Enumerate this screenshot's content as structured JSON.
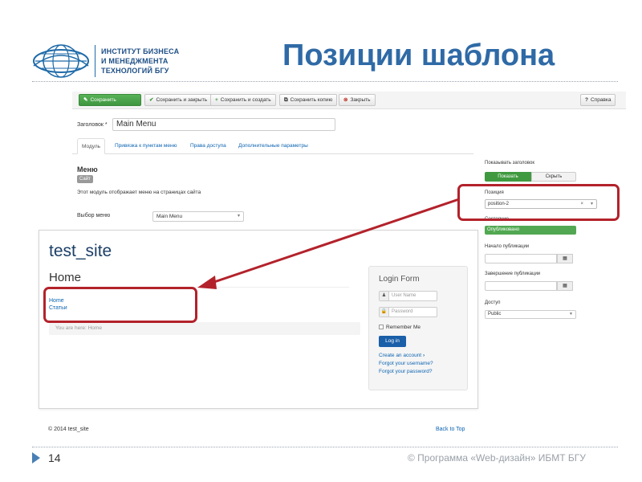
{
  "header": {
    "logo_lines": [
      "ИНСТИТУТ БИЗНЕСА",
      "И МЕНЕДЖМЕНТА",
      "ТЕХНОЛОГИЙ БГУ"
    ],
    "slide_title": "Позиции шаблона"
  },
  "toolbar": {
    "save": "Сохранить",
    "save_close": "Сохранить и закрыть",
    "save_new": "Сохранить и создать",
    "save_copy": "Сохранить копию",
    "close": "Закрыть",
    "help": "Справка"
  },
  "form": {
    "title_label": "Заголовок *",
    "title_value": "Main Menu",
    "tabs": [
      "Модуль",
      "Привязка к пунктам меню",
      "Права доступа",
      "Дополнительные параметры"
    ],
    "module_title": "Меню",
    "site_badge": "Сайт",
    "module_desc": "Этот модуль отображает меню на страницах сайта",
    "menu_select_label": "Выбор меню",
    "menu_select_value": "Main Menu"
  },
  "sidebar": {
    "show_title_label": "Показывать заголовок",
    "show_btn": "Показать",
    "hide_btn": "Скрыть",
    "position_label": "Позиция",
    "position_value": "position-2",
    "status_label": "Состояние",
    "status_value": "Опубликовано",
    "publish_start_label": "Начало публикации",
    "publish_end_label": "Завершение публикации",
    "access_label": "Доступ",
    "access_value": "Public"
  },
  "preview": {
    "site_title": "test_site",
    "page_title": "Home",
    "menu_items": [
      "Home",
      "Статьи"
    ],
    "breadcrumb": "You are here:  Home",
    "login": {
      "title": "Login Form",
      "username_placeholder": "User Name",
      "password_placeholder": "Password",
      "remember": "Remember Me",
      "button": "Log in",
      "create_account": "Create an account",
      "forgot_username": "Forgot your username?",
      "forgot_password": "Forgot your password?"
    },
    "footer_copy": "© 2014 test_site",
    "back_to_top": "Back to Top"
  },
  "footer": {
    "slide_number": "14",
    "copyright": "© Программа «Web-дизайн» ИБМТ БГУ"
  },
  "colors": {
    "title_blue": "#2f6aa6",
    "highlight_red": "#b3222b",
    "save_green": "#3f963f"
  }
}
